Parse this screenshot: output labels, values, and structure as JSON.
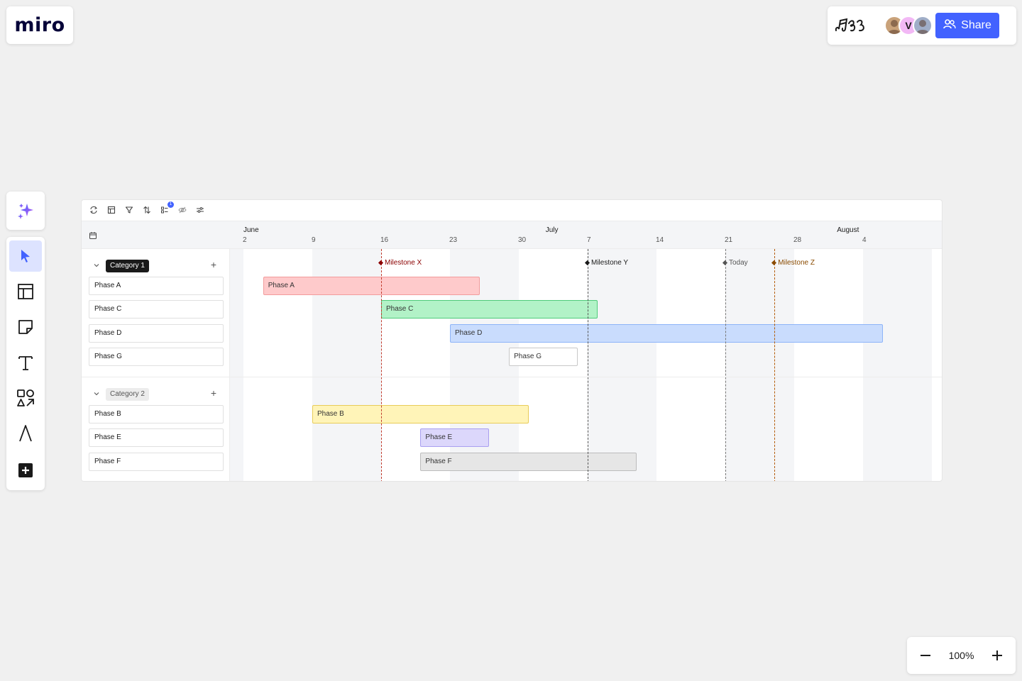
{
  "logo": {
    "text": "miro"
  },
  "header": {
    "share_label": "Share",
    "avatars": [
      {
        "initial": "",
        "color": "#c9a27a"
      },
      {
        "initial": "V",
        "color": "#f2b8f5"
      },
      {
        "initial": "",
        "color": "#a0aec8"
      }
    ]
  },
  "zoom": {
    "value": "100%"
  },
  "timeline": {
    "toolbar_badge": "1",
    "months": [
      {
        "label": "June",
        "day_index": 0
      },
      {
        "label": "July",
        "day_index": 30
      },
      {
        "label": "August",
        "day_index": 61
      }
    ],
    "days": [
      {
        "label": "2",
        "day_index": 0
      },
      {
        "label": "9",
        "day_index": 7
      },
      {
        "label": "16",
        "day_index": 14
      },
      {
        "label": "23",
        "day_index": 21
      },
      {
        "label": "30",
        "day_index": 28
      },
      {
        "label": "7",
        "day_index": 35
      },
      {
        "label": "14",
        "day_index": 42
      },
      {
        "label": "21",
        "day_index": 49
      },
      {
        "label": "28",
        "day_index": 56
      },
      {
        "label": "4",
        "day_index": 63
      }
    ],
    "milestones": [
      {
        "label": "Milestone X",
        "day_index": 14,
        "color": "#8b0000",
        "line_color": "#c0392b"
      },
      {
        "label": "Milestone Y",
        "day_index": 35,
        "color": "#1a1a1a",
        "line_color": "#555555"
      },
      {
        "label": "Today",
        "day_index": 49,
        "color": "#555555",
        "line_color": "#777777"
      },
      {
        "label": "Milestone Z",
        "day_index": 54,
        "color": "#8a4b00",
        "line_color": "#b35900"
      }
    ],
    "categories": [
      {
        "label": "Category 1",
        "style": "dark",
        "phases": [
          {
            "label": "Phase A",
            "bar_label": "Phase A",
            "start": 2,
            "end": 24,
            "fill": "#fecacb",
            "border": "#f29b9c"
          },
          {
            "label": "Phase C",
            "bar_label": "Phase C",
            "start": 14,
            "end": 36,
            "fill": "#b2f2c7",
            "border": "#4ecb7a"
          },
          {
            "label": "Phase D",
            "bar_label": "Phase D",
            "start": 21,
            "end": 65,
            "fill": "#c9dcfd",
            "border": "#8db4f8"
          },
          {
            "label": "Phase G",
            "bar_label": "Phase G",
            "start": 27,
            "end": 34,
            "fill": "#ffffff",
            "border": "#c8c8c8"
          }
        ]
      },
      {
        "label": "Category 2",
        "style": "light",
        "phases": [
          {
            "label": "Phase B",
            "bar_label": "Phase B",
            "start": 7,
            "end": 29,
            "fill": "#fff4b8",
            "border": "#e8cc58"
          },
          {
            "label": "Phase E",
            "bar_label": "Phase E",
            "start": 18,
            "end": 25,
            "fill": "#dcd7fb",
            "border": "#a99ff0"
          },
          {
            "label": "Phase F",
            "bar_label": "Phase F",
            "start": 18,
            "end": 40,
            "fill": "#e6e6e6",
            "border": "#bcbcbc"
          }
        ]
      }
    ]
  }
}
